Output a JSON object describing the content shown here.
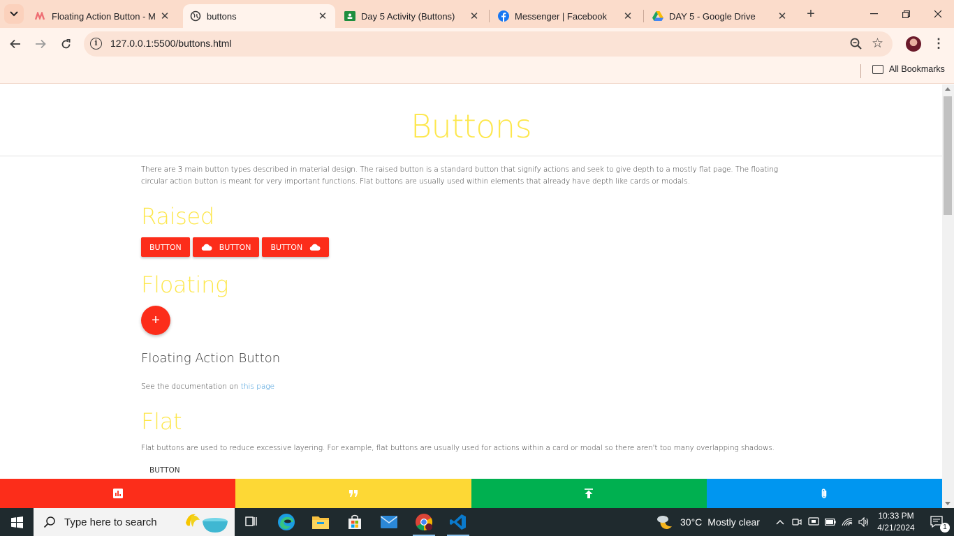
{
  "browser": {
    "tabs": [
      {
        "title": "Floating Action Button - Ma",
        "icon": "materialize-icon",
        "active": false
      },
      {
        "title": "buttons",
        "icon": "globe-icon",
        "active": true
      },
      {
        "title": "Day 5 Activity (Buttons)",
        "icon": "google-classroom-icon",
        "active": false
      },
      {
        "title": "Messenger | Facebook",
        "icon": "facebook-icon",
        "active": false
      },
      {
        "title": "DAY 5 - Google Drive",
        "icon": "google-drive-icon",
        "active": false
      }
    ],
    "url": "127.0.0.1:5500/buttons.html",
    "bookmarks_label": "All Bookmarks"
  },
  "page": {
    "title": "Buttons",
    "intro": "There are 3 main button types described in material design. The raised button is a standard button that signify actions and seek to give depth to a mostly flat page. The floating circular action button is meant for very important functions. Flat buttons are usually used within elements that already have depth like cards or modals.",
    "raised": {
      "heading": "Raised",
      "buttons": [
        "BUTTON",
        "BUTTON",
        "BUTTON"
      ]
    },
    "floating": {
      "heading": "Floating",
      "fab_symbol": "+",
      "subheading": "Floating Action Button",
      "doc_prefix": "See the documentation on",
      "doc_link": "this page"
    },
    "flat": {
      "heading": "Flat",
      "description": "Flat buttons are used to reduce excessive layering. For example, flat buttons are usually used for actions within a card or modal so there aren't too many overlapping shadows.",
      "button": "BUTTON"
    },
    "bottom_bar": [
      {
        "icon": "chart-icon",
        "color": "#fc2d1a"
      },
      {
        "icon": "quote-icon",
        "color": "#fdd835"
      },
      {
        "icon": "upload-icon",
        "color": "#00b050"
      },
      {
        "icon": "attachment-icon",
        "color": "#0096f0"
      }
    ],
    "accent_colors": {
      "title": "#fde74c",
      "button": "#fc2d1a",
      "link": "#2b8fd6"
    }
  },
  "taskbar": {
    "search_placeholder": "Type here to search",
    "weather_temp": "30°C",
    "weather_desc": "Mostly clear",
    "time": "10:33 PM",
    "date": "4/21/2024",
    "notification_count": "1"
  }
}
